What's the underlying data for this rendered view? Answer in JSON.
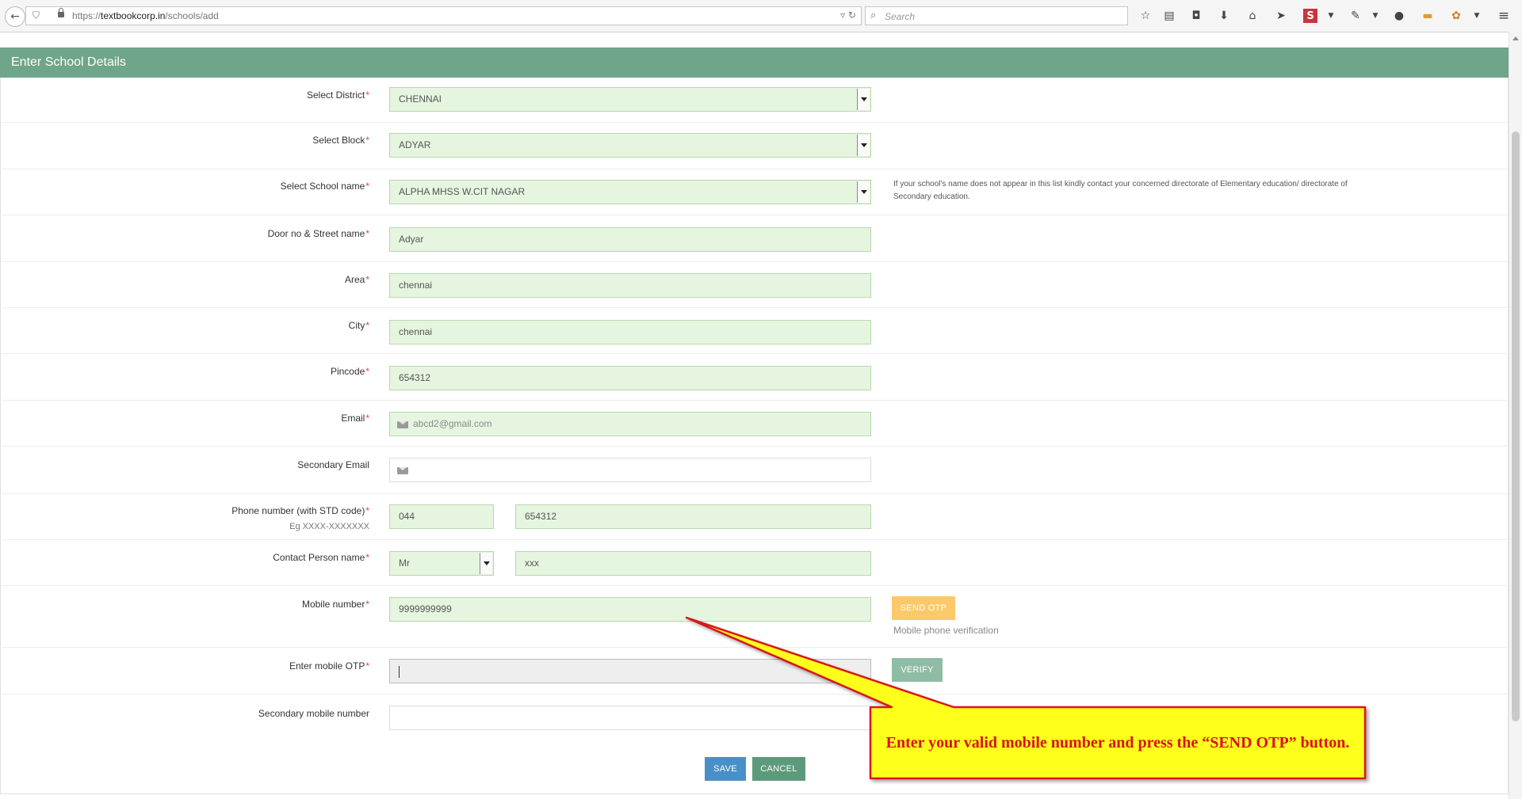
{
  "browser": {
    "url_scheme": "https://",
    "url_host": "textbookcorp.in",
    "url_path": "/schools/add",
    "search_placeholder": "Search",
    "toolbar_icons": [
      "star-icon",
      "reader-icon",
      "pocket-icon",
      "download-icon",
      "home-icon",
      "send-icon",
      "s-logo-icon",
      "dropdown-icon",
      "pipette-icon",
      "dropdown-icon",
      "chat-icon",
      "note-icon",
      "extension-icon",
      "dropdown-icon",
      "menu-icon"
    ]
  },
  "header": {
    "title": "Enter School Details"
  },
  "form": {
    "district": {
      "label": "Select District",
      "value": "CHENNAI"
    },
    "block": {
      "label": "Select Block",
      "value": "ADYAR"
    },
    "school": {
      "label": "Select School name",
      "value": "ALPHA MHSS W.CIT NAGAR",
      "note": "If your school's name does not appear in this list kindly contact your concerned directorate of Elementary education/ directorate of Secondary education."
    },
    "street": {
      "label": "Door no & Street name",
      "value": "Adyar"
    },
    "area": {
      "label": "Area",
      "value": "chennai"
    },
    "city": {
      "label": "City",
      "value": "chennai"
    },
    "pincode": {
      "label": "Pincode",
      "value": "654312"
    },
    "email": {
      "label": "Email",
      "value": "abcd2@gmail.com"
    },
    "secondary_email": {
      "label": "Secondary Email",
      "value": ""
    },
    "phone": {
      "label": "Phone number (with STD code)",
      "hint": "Eg XXXX-XXXXXXX",
      "std": "044",
      "number": "654312"
    },
    "contact": {
      "label": "Contact Person name",
      "title": "Mr",
      "name": "xxx"
    },
    "mobile": {
      "label": "Mobile number",
      "value": "9999999999",
      "send_otp": "SEND OTP",
      "verification_text": "Mobile phone verification"
    },
    "otp": {
      "label": "Enter mobile OTP",
      "value": "",
      "verify": "VERIFY"
    },
    "secondary_mobile": {
      "label": "Secondary mobile number",
      "value": ""
    },
    "required_mark": "*"
  },
  "actions": {
    "save": "SAVE",
    "cancel": "CANCEL"
  },
  "callout": {
    "text": "Enter your valid mobile number and press the “SEND OTP” button."
  },
  "colors": {
    "header_bg": "#6fa58a",
    "field_bg": "#e6f5e0",
    "send_otp_bg": "#fcc96a",
    "verify_bg": "#8fbca4",
    "save_bg": "#4a90c8",
    "cancel_bg": "#5d9a7c",
    "callout_fill": "#ffff1a",
    "callout_stroke": "#d8131a"
  }
}
